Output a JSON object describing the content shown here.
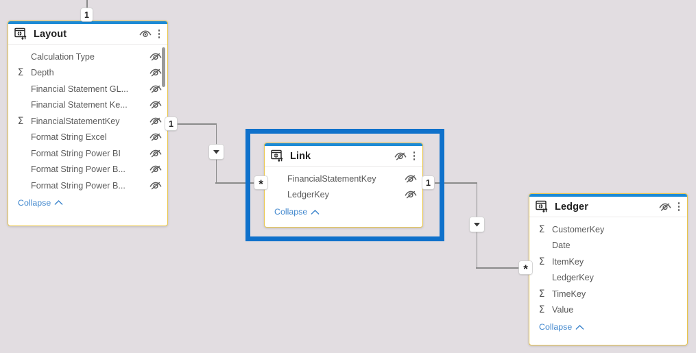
{
  "canvas": {
    "background_color": "#e2dde1",
    "selection_color": "#0f71cb",
    "table_border_color": "#e8c54a",
    "table_accent_color": "#1c8ad6",
    "link_color": "#3f86cd"
  },
  "tables": [
    {
      "name": "Layout",
      "icon": "table-source-icon",
      "visibility_icon": "eye-visible-icon",
      "menu_icon": "more-options-icon",
      "collapse_label": "Collapse",
      "has_scrollbar": true,
      "fields": [
        {
          "name": "Calculation Type",
          "aggregate": "",
          "hidden_icon": "eye-hidden-icon"
        },
        {
          "name": "Depth",
          "aggregate": "Σ",
          "hidden_icon": "eye-hidden-icon"
        },
        {
          "name": "Financial Statement GL...",
          "aggregate": "",
          "hidden_icon": "eye-hidden-icon"
        },
        {
          "name": "Financial Statement Ke...",
          "aggregate": "",
          "hidden_icon": "eye-hidden-icon"
        },
        {
          "name": "FinancialStatementKey",
          "aggregate": "Σ",
          "hidden_icon": "eye-hidden-icon"
        },
        {
          "name": "Format String Excel",
          "aggregate": "",
          "hidden_icon": "eye-hidden-icon"
        },
        {
          "name": "Format String Power BI",
          "aggregate": "",
          "hidden_icon": "eye-hidden-icon"
        },
        {
          "name": "Format String Power B...",
          "aggregate": "",
          "hidden_icon": "eye-hidden-icon"
        },
        {
          "name": "Format String Power B...",
          "aggregate": "",
          "hidden_icon": "eye-hidden-icon"
        }
      ]
    },
    {
      "name": "Link",
      "icon": "table-source-icon",
      "visibility_icon": "eye-hidden-icon",
      "menu_icon": "more-options-icon",
      "collapse_label": "Collapse",
      "selected": true,
      "has_scrollbar": false,
      "fields": [
        {
          "name": "FinancialStatementKey",
          "aggregate": "",
          "hidden_icon": "eye-hidden-icon"
        },
        {
          "name": "LedgerKey",
          "aggregate": "",
          "hidden_icon": "eye-hidden-icon"
        }
      ]
    },
    {
      "name": "Ledger",
      "icon": "table-source-icon",
      "visibility_icon": "eye-hidden-icon",
      "menu_icon": "more-options-icon",
      "collapse_label": "Collapse",
      "has_scrollbar": false,
      "fields": [
        {
          "name": "CustomerKey",
          "aggregate": "Σ",
          "hidden_icon": "eye-hidden-icon"
        },
        {
          "name": "Date",
          "aggregate": "",
          "hidden_icon": "eye-hidden-icon"
        },
        {
          "name": "ItemKey",
          "aggregate": "Σ",
          "hidden_icon": "eye-hidden-icon"
        },
        {
          "name": "LedgerKey",
          "aggregate": "",
          "hidden_icon": "eye-hidden-icon"
        },
        {
          "name": "TimeKey",
          "aggregate": "Σ",
          "hidden_icon": "eye-hidden-icon"
        },
        {
          "name": "Value",
          "aggregate": "Σ",
          "hidden_icon": "eye-hidden-icon"
        }
      ]
    }
  ],
  "relationships": [
    {
      "id": "layout-top-stub",
      "from_cardinality": "1",
      "to_cardinality": "",
      "direction_icon": ""
    },
    {
      "id": "layout-to-link",
      "from_table": "Layout",
      "to_table": "Link",
      "from_cardinality": "1",
      "to_cardinality": "*",
      "direction_icon": "filter-direction-down-icon"
    },
    {
      "id": "link-to-ledger",
      "from_table": "Link",
      "to_table": "Ledger",
      "from_cardinality": "1",
      "to_cardinality": "*",
      "direction_icon": "filter-direction-down-icon"
    }
  ]
}
